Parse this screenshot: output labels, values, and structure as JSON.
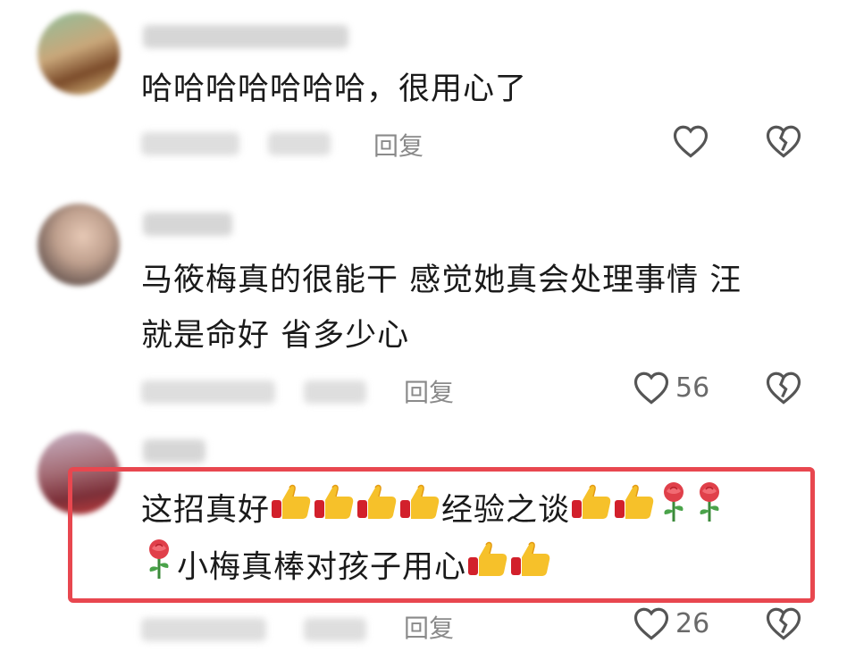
{
  "comments": [
    {
      "text": "哈哈哈哈哈哈哈，很用心了",
      "reply_label": "回复",
      "like_count": ""
    },
    {
      "text_line1": "马筱梅真的很能干 感觉她真会处理事情 汪",
      "text_line2": "就是命好 省多少心",
      "reply_label": "回复",
      "like_count": "56"
    },
    {
      "line1_a": "这招真好",
      "line1_b": "经验之谈",
      "line2": "小梅真棒对孩子用心",
      "reply_label": "回复",
      "like_count": "26"
    }
  ],
  "icons": {
    "like": "heart-outline-icon",
    "dislike": "broken-heart-icon",
    "thumbs": "thumbs-up-emoji",
    "rose": "rose-emoji"
  },
  "colors": {
    "highlight": "#e8474f",
    "meta": "#8a8a8a"
  }
}
